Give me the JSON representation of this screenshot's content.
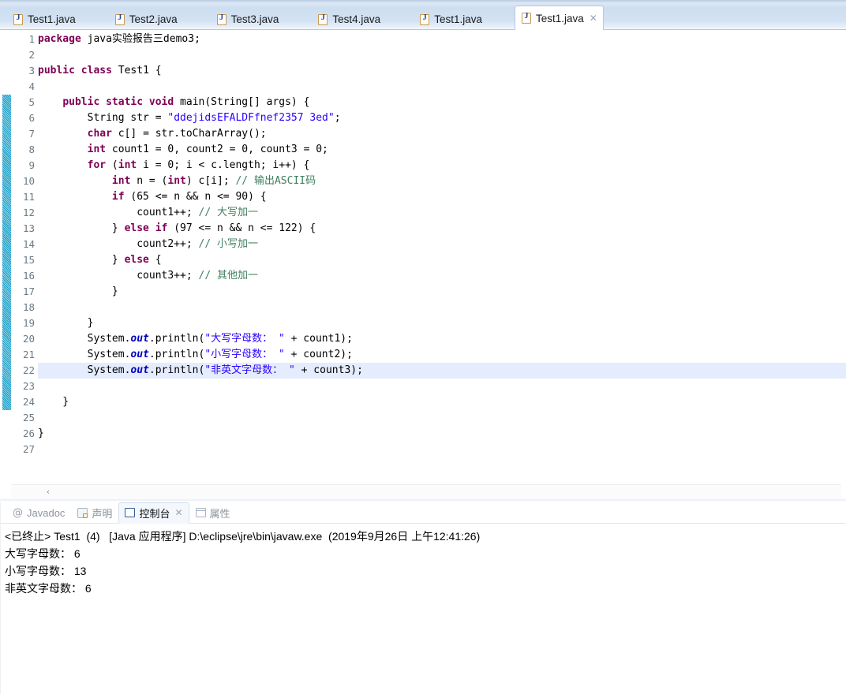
{
  "editor": {
    "tabs": [
      {
        "label": "Test1.java",
        "icon": "java-file-icon",
        "active": false,
        "closable": false
      },
      {
        "label": "Test2.java",
        "icon": "java-file-icon",
        "active": false,
        "closable": false
      },
      {
        "label": "Test3.java",
        "icon": "java-file-icon",
        "active": false,
        "closable": false
      },
      {
        "label": "Test4.java",
        "icon": "java-file-icon",
        "active": false,
        "closable": false
      },
      {
        "label": "Test1.java",
        "icon": "java-file-icon",
        "active": false,
        "closable": false
      },
      {
        "label": "Test1.java",
        "icon": "java-file-icon",
        "active": true,
        "closable": true
      }
    ],
    "close_glyph": "✕",
    "scroll_left_glyph": "‹",
    "highlighted_line": 22,
    "folding_marker_line": 5,
    "annotation_bar_from_line": 5,
    "annotation_bar_to_line": 24,
    "line_numbers": [
      1,
      2,
      3,
      4,
      5,
      6,
      7,
      8,
      9,
      10,
      11,
      12,
      13,
      14,
      15,
      16,
      17,
      18,
      19,
      20,
      21,
      22,
      23,
      24,
      25,
      26,
      27
    ],
    "code_lines": [
      {
        "n": 1,
        "text": "package java实验报告三demo3;"
      },
      {
        "n": 2,
        "text": ""
      },
      {
        "n": 3,
        "text": "public class Test1 {"
      },
      {
        "n": 4,
        "text": ""
      },
      {
        "n": 5,
        "text": "    public static void main(String[] args) {"
      },
      {
        "n": 6,
        "text": "        String str = \"ddejidsEFALDFfnef2357 3ed\";"
      },
      {
        "n": 7,
        "text": "        char c[] = str.toCharArray();"
      },
      {
        "n": 8,
        "text": "        int count1 = 0, count2 = 0, count3 = 0;"
      },
      {
        "n": 9,
        "text": "        for (int i = 0; i < c.length; i++) {"
      },
      {
        "n": 10,
        "text": "            int n = (int) c[i]; // 输出ASCII码"
      },
      {
        "n": 11,
        "text": "            if (65 <= n && n <= 90) {"
      },
      {
        "n": 12,
        "text": "                count1++; // 大写加一"
      },
      {
        "n": 13,
        "text": "            } else if (97 <= n && n <= 122) {"
      },
      {
        "n": 14,
        "text": "                count2++; // 小写加一"
      },
      {
        "n": 15,
        "text": "            } else {"
      },
      {
        "n": 16,
        "text": "                count3++; // 其他加一"
      },
      {
        "n": 17,
        "text": "            }"
      },
      {
        "n": 18,
        "text": ""
      },
      {
        "n": 19,
        "text": "        }"
      },
      {
        "n": 20,
        "text": "        System.out.println(\"大写字母数： \" + count1);"
      },
      {
        "n": 21,
        "text": "        System.out.println(\"小写字母数： \" + count2);"
      },
      {
        "n": 22,
        "text": "        System.out.println(\"非英文字母数： \" + count3);"
      },
      {
        "n": 23,
        "text": ""
      },
      {
        "n": 24,
        "text": "    }"
      },
      {
        "n": 25,
        "text": ""
      },
      {
        "n": 26,
        "text": "}"
      },
      {
        "n": 27,
        "text": ""
      }
    ]
  },
  "bottom_panel": {
    "tabs": [
      {
        "label": "Javadoc",
        "icon": "at-icon",
        "active": false,
        "closable": false
      },
      {
        "label": "声明",
        "icon": "declaration-icon",
        "active": false,
        "closable": false
      },
      {
        "label": "控制台",
        "icon": "console-icon",
        "active": true,
        "closable": true
      },
      {
        "label": "属性",
        "icon": "properties-icon",
        "active": false,
        "closable": false
      }
    ],
    "close_glyph": "✕",
    "console": {
      "header": "<已终止> Test1  (4)   [Java 应用程序] D:\\eclipse\\jre\\bin\\javaw.exe  (2019年9月26日 上午12:41:26)",
      "lines": [
        "大写字母数： 6",
        "小写字母数： 13",
        "非英文字母数： 6"
      ]
    }
  },
  "colors": {
    "keyword": "#7f0055",
    "string": "#2a00ff",
    "comment": "#3f7f5f",
    "field": "#0000c0",
    "line_highlight": "#e4ecfd",
    "annotation_bar": "#2aa5c9",
    "tab_active_bg": "#ffffff",
    "tabbar_bg": "#cddef0"
  }
}
